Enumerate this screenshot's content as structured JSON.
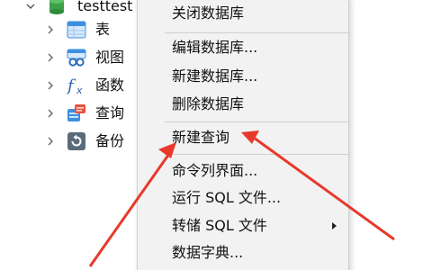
{
  "tree": {
    "database": {
      "name": "testtest"
    },
    "children": [
      {
        "label": "表",
        "icon": "table-icon"
      },
      {
        "label": "视图",
        "icon": "view-icon"
      },
      {
        "label": "函数",
        "icon": "function-icon"
      },
      {
        "label": "查询",
        "icon": "query-icon"
      },
      {
        "label": "备份",
        "icon": "backup-icon"
      }
    ]
  },
  "context_menu": {
    "items": [
      {
        "label": "关闭数据库"
      },
      {
        "label": "编辑数据库..."
      },
      {
        "label": "新建数据库..."
      },
      {
        "label": "删除数据库"
      },
      {
        "label": "新建查询",
        "highlighted_by_arrows": true
      },
      {
        "label": "命令列界面..."
      },
      {
        "label": "运行 SQL 文件..."
      },
      {
        "label": "转储 SQL 文件",
        "has_submenu": true
      },
      {
        "label": "数据字典..."
      }
    ]
  },
  "annotation": {
    "arrow_color": "#e8392b"
  }
}
